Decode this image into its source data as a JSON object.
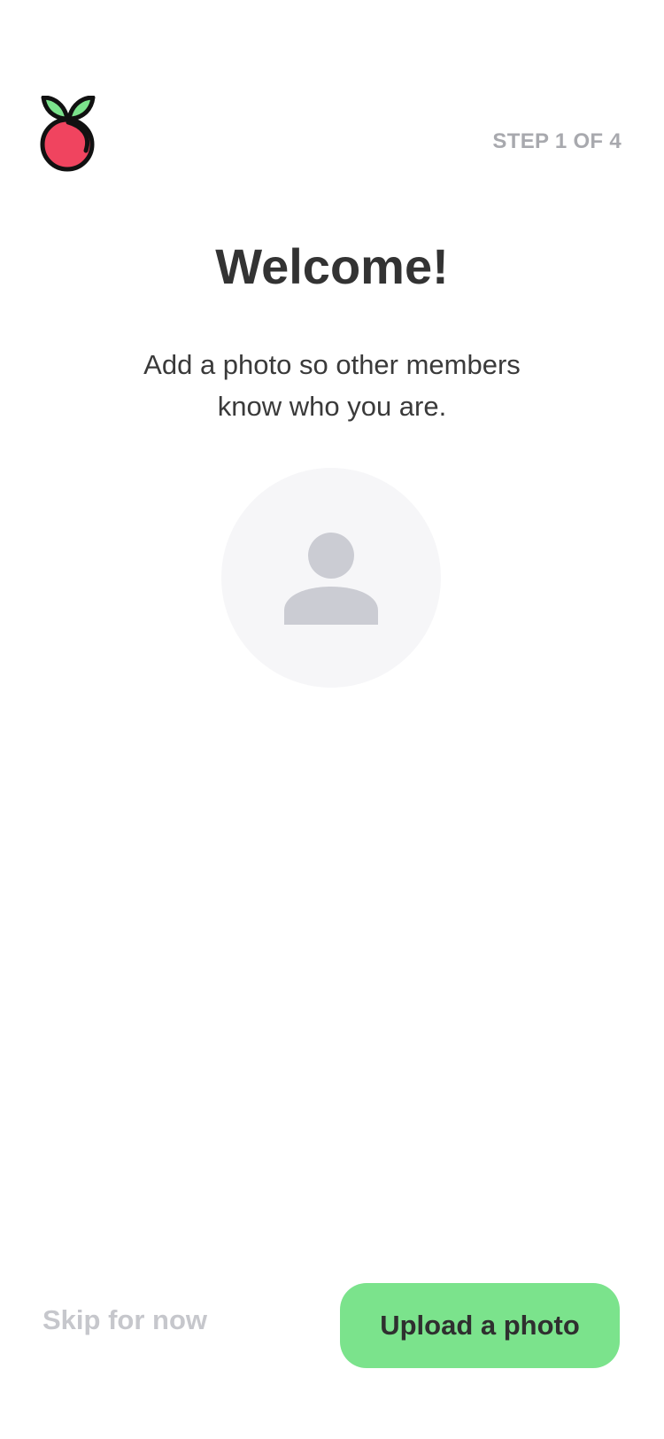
{
  "header": {
    "logo_icon": "cherry-logo-icon",
    "step_text": "STEP 1 OF 4"
  },
  "main": {
    "title": "Welcome!",
    "subtitle": "Add a photo so other members know who you are.",
    "avatar_icon": "user-placeholder-icon"
  },
  "actions": {
    "skip_label": "Skip for now",
    "upload_label": "Upload a photo"
  },
  "colors": {
    "accent_green": "#7be38c",
    "logo_red": "#f0445f",
    "logo_leaf": "#7be38c",
    "muted_gray": "#a8a9ae",
    "avatar_bg": "#f6f6f8",
    "avatar_icon": "#cbccd3"
  }
}
